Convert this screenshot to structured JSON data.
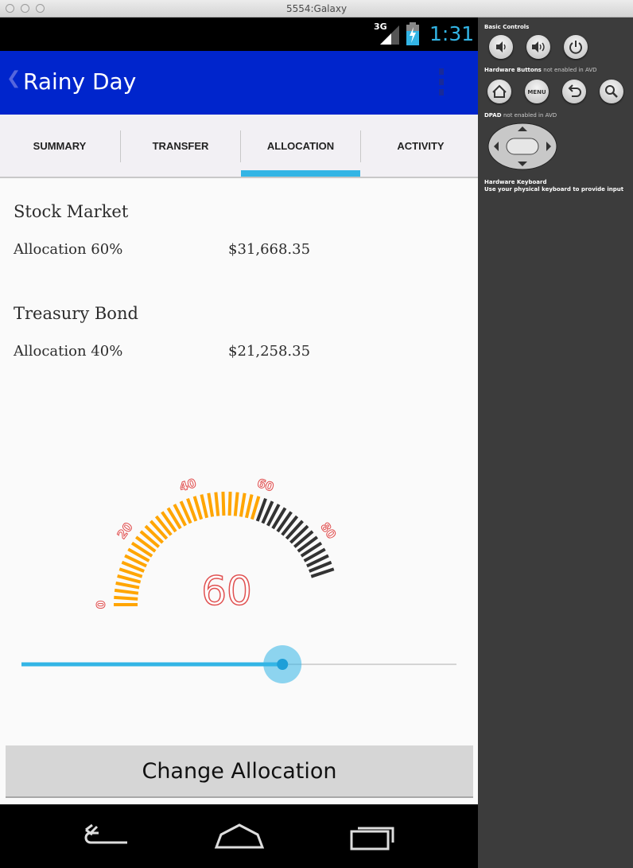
{
  "window": {
    "title": "5554:Galaxy"
  },
  "statusbar": {
    "network": "3G",
    "time": "1:31"
  },
  "actionbar": {
    "back_glyph": "❮",
    "title": "Rainy Day"
  },
  "tabs": [
    {
      "label": "SUMMARY",
      "selected": false
    },
    {
      "label": "TRANSFER",
      "selected": false
    },
    {
      "label": "ALLOCATION",
      "selected": true
    },
    {
      "label": "ACTIVITY",
      "selected": false
    }
  ],
  "accent_color": "#33b5e5",
  "brand_color": "#0025cc",
  "funds": [
    {
      "name": "Stock Market",
      "allocation": "Allocation 60%",
      "amount": "$31,668.35"
    },
    {
      "name": "Treasury Bond",
      "allocation": "Allocation 40%",
      "amount": "$21,258.35"
    }
  ],
  "gauge": {
    "value": 60,
    "value_label": "60",
    "min": 0,
    "max": 100,
    "tick_labels": [
      "0",
      "20",
      "40",
      "60",
      "80"
    ],
    "filled_color": "#ffa500",
    "empty_color": "#333333"
  },
  "slider": {
    "value_fraction": 0.6
  },
  "change_button": {
    "label": "Change Allocation"
  },
  "navbar": {
    "icons": [
      "back-icon",
      "home-icon",
      "recent-apps-icon"
    ]
  },
  "emulator_panel": {
    "basic_controls": "Basic Controls",
    "hardware_buttons": "Hardware Buttons",
    "hardware_buttons_note": "not enabled in AVD",
    "dpad": "DPAD",
    "dpad_note": "not enabled in AVD",
    "keyboard_title": "Hardware Keyboard",
    "keyboard_note": "Use your physical keyboard to provide input",
    "menu_label": "MENU"
  }
}
